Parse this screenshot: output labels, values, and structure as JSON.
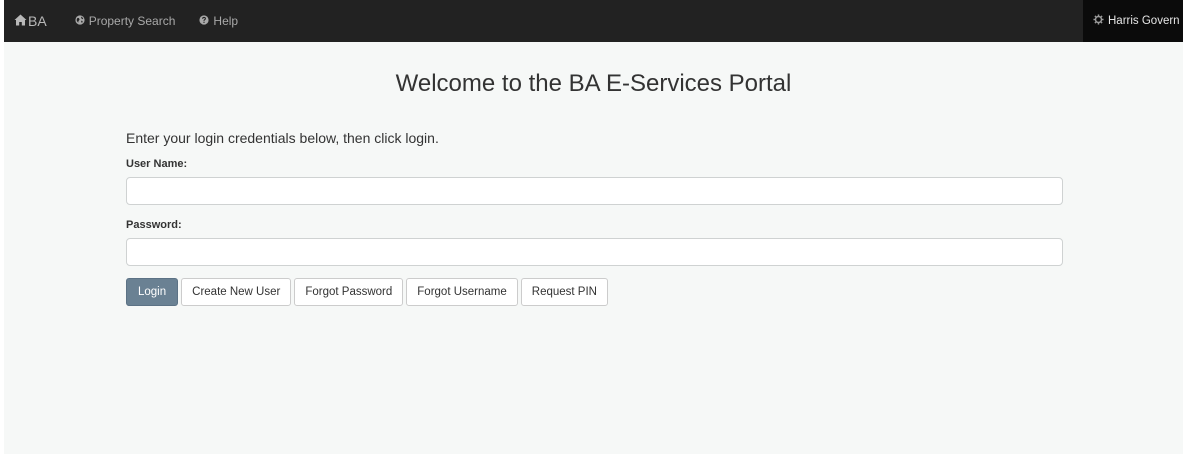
{
  "navbar": {
    "brand_label": "BA",
    "brand_icon": "home-icon",
    "links": [
      {
        "label": "Property Search",
        "icon": "globe-icon"
      },
      {
        "label": "Help",
        "icon": "question-circle-icon"
      }
    ],
    "right_label": "Harris Govern",
    "right_icon": "gear-icon"
  },
  "page": {
    "title": "Welcome to the BA E-Services Portal",
    "intro": "Enter your login credentials below, then click login."
  },
  "form": {
    "username_label": "User Name:",
    "username_value": "",
    "password_label": "Password:",
    "password_value": ""
  },
  "buttons": {
    "login": "Login",
    "create_user": "Create New User",
    "forgot_password": "Forgot Password",
    "forgot_username": "Forgot Username",
    "request_pin": "Request PIN"
  },
  "colors": {
    "navbar_bg": "#222222",
    "primary_button": "#6a8193",
    "page_bg": "#f6f8f7"
  }
}
